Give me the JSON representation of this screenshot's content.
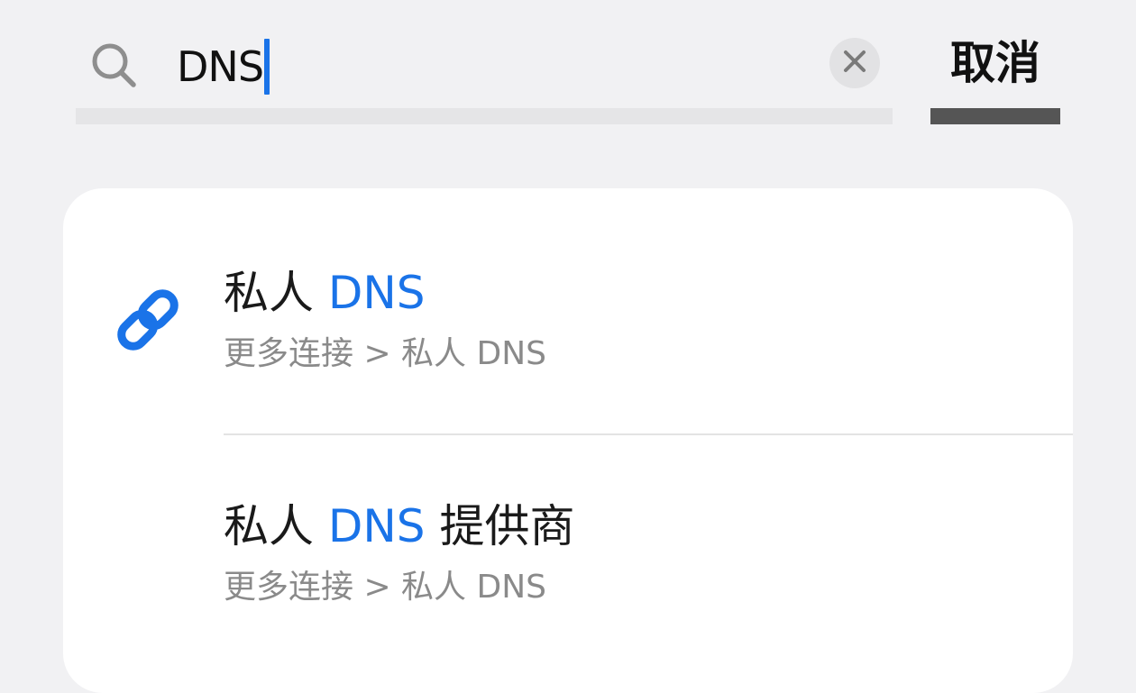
{
  "search": {
    "query": "DNS",
    "search_icon": "search-icon",
    "clear_icon": "close-icon"
  },
  "cancel_label": "取消",
  "results": [
    {
      "icon": "link-icon",
      "title_prefix": "私人",
      "title_match": "DNS",
      "title_suffix": "",
      "path": "更多连接 > 私人 DNS"
    },
    {
      "icon": "",
      "title_prefix": "私人",
      "title_match": "DNS",
      "title_suffix": "提供商",
      "path": "更多连接 > 私人 DNS"
    }
  ],
  "colors": {
    "accent": "#1a73e8",
    "background": "#f1f1f3",
    "card": "#ffffff",
    "secondary_text": "#8a8a8a"
  }
}
